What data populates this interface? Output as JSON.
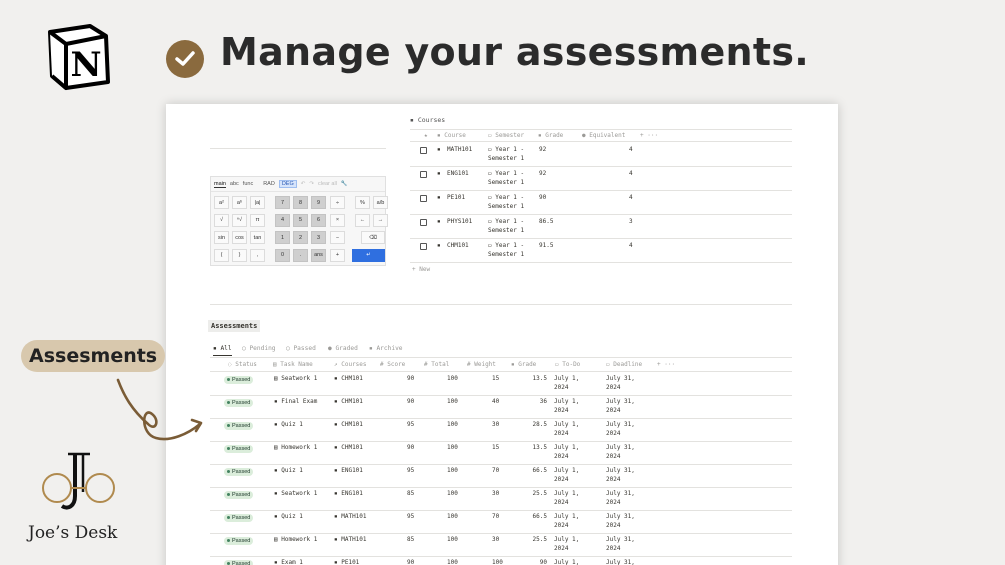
{
  "header": {
    "title": "Manage your assessments.",
    "logo_letter": "N",
    "check_color": "#8a6a3e"
  },
  "side": {
    "label": "Assesments",
    "brand": "Joe’s Desk",
    "accent": "#d8c8ad"
  },
  "calculator": {
    "tabs": [
      "main",
      "abc",
      "func",
      "RAD",
      "DEG",
      "undo",
      "redo",
      "clear all"
    ],
    "keys": [
      "a²",
      "aᵇ",
      "|a|",
      "7",
      "8",
      "9",
      "÷",
      "%",
      "a/b",
      "√",
      "ⁿ√",
      "π",
      "4",
      "5",
      "6",
      "×",
      "←",
      "→",
      "sin",
      "cos",
      "tan",
      "1",
      "2",
      "3",
      "−",
      "⌫",
      "(",
      ")",
      ",",
      "0",
      ".",
      "ans",
      "+",
      "↵"
    ]
  },
  "courses": {
    "title": "Courses",
    "columns": [
      "Course",
      "Semester",
      "Grade",
      "Equivalent"
    ],
    "rows": [
      {
        "course": "MATH101",
        "sem1": "Year 1 -",
        "sem2": "Semester 1",
        "grade": "92",
        "eq": "4"
      },
      {
        "course": "ENG101",
        "sem1": "Year 1 -",
        "sem2": "Semester 1",
        "grade": "92",
        "eq": "4"
      },
      {
        "course": "PE101",
        "sem1": "Year 1 -",
        "sem2": "Semester 1",
        "grade": "90",
        "eq": "4"
      },
      {
        "course": "PHYS101",
        "sem1": "Year 1 -",
        "sem2": "Semester 1",
        "grade": "86.5",
        "eq": "3"
      },
      {
        "course": "CHM101",
        "sem1": "Year 1 -",
        "sem2": "Semester 1",
        "grade": "91.5",
        "eq": "4"
      }
    ],
    "new_label": "+ New"
  },
  "assessments": {
    "title": "Assessments",
    "tabs": [
      "All",
      "Pending",
      "Passed",
      "Graded",
      "Archive"
    ],
    "columns": [
      "Status",
      "Task Name",
      "Courses",
      "Score",
      "Total",
      "Weight",
      "Grade",
      "To-Do",
      "Deadline"
    ],
    "rows": [
      {
        "status": "Passed",
        "task": "Seatwork 1",
        "course": "CHM101",
        "score": "90",
        "total": "100",
        "weight": "15",
        "grade": "13.5",
        "todo1": "July 1,",
        "todo2": "2024",
        "dl1": "July 31,",
        "dl2": "2024"
      },
      {
        "status": "Passed",
        "task": "Final Exam",
        "course": "CHM101",
        "score": "90",
        "total": "100",
        "weight": "40",
        "grade": "36",
        "todo1": "July 1,",
        "todo2": "2024",
        "dl1": "July 31,",
        "dl2": "2024"
      },
      {
        "status": "Passed",
        "task": "Quiz 1",
        "course": "CHM101",
        "score": "95",
        "total": "100",
        "weight": "30",
        "grade": "28.5",
        "todo1": "July 1,",
        "todo2": "2024",
        "dl1": "July 31,",
        "dl2": "2024"
      },
      {
        "status": "Passed",
        "task": "Homework 1",
        "course": "CHM101",
        "score": "90",
        "total": "100",
        "weight": "15",
        "grade": "13.5",
        "todo1": "July 1,",
        "todo2": "2024",
        "dl1": "July 31,",
        "dl2": "2024"
      },
      {
        "status": "Passed",
        "task": "Quiz 1",
        "course": "ENG101",
        "score": "95",
        "total": "100",
        "weight": "70",
        "grade": "66.5",
        "todo1": "July 1,",
        "todo2": "2024",
        "dl1": "July 31,",
        "dl2": "2024"
      },
      {
        "status": "Passed",
        "task": "Seatwork 1",
        "course": "ENG101",
        "score": "85",
        "total": "100",
        "weight": "30",
        "grade": "25.5",
        "todo1": "July 1,",
        "todo2": "2024",
        "dl1": "July 31,",
        "dl2": "2024"
      },
      {
        "status": "Passed",
        "task": "Quiz 1",
        "course": "MATH101",
        "score": "95",
        "total": "100",
        "weight": "70",
        "grade": "66.5",
        "todo1": "July 1,",
        "todo2": "2024",
        "dl1": "July 31,",
        "dl2": "2024"
      },
      {
        "status": "Passed",
        "task": "Homework 1",
        "course": "MATH101",
        "score": "85",
        "total": "100",
        "weight": "30",
        "grade": "25.5",
        "todo1": "July 1,",
        "todo2": "2024",
        "dl1": "July 31,",
        "dl2": "2024"
      },
      {
        "status": "Passed",
        "task": "Exam 1",
        "course": "PE101",
        "score": "90",
        "total": "100",
        "weight": "100",
        "grade": "90",
        "todo1": "July 1,",
        "todo2": "2024",
        "dl1": "July 31,",
        "dl2": "2024"
      }
    ]
  }
}
